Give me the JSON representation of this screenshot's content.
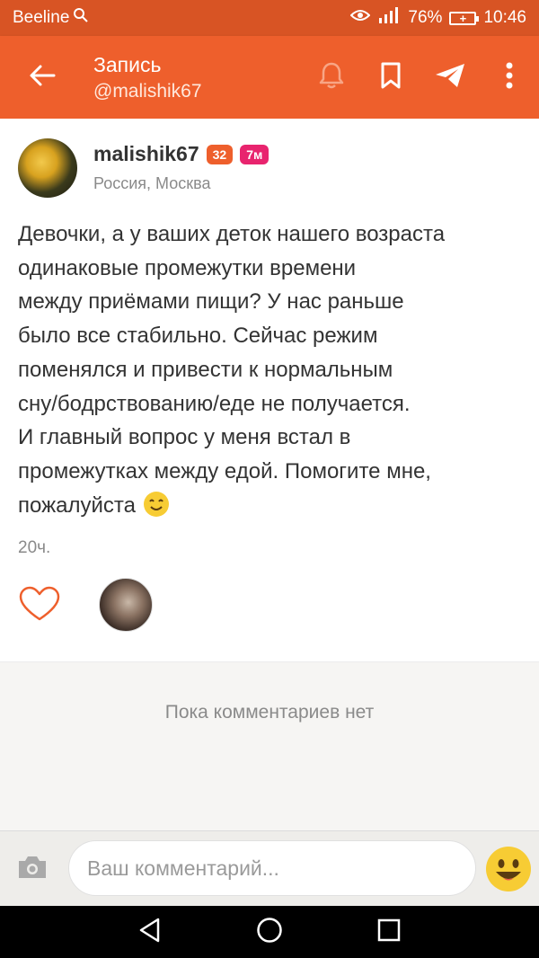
{
  "status_bar": {
    "carrier": "Beeline",
    "battery": "76%",
    "time": "10:46"
  },
  "app_bar": {
    "title": "Запись",
    "subtitle": "@malishik67",
    "icons": [
      "back-arrow-icon",
      "bell-icon",
      "bookmark-icon",
      "send-icon",
      "more-vert-icon"
    ],
    "color": "#ee5f2c"
  },
  "post": {
    "author": "malishik67",
    "badge_level": "32",
    "badge_age": "7м",
    "location": "Россия, Москва",
    "text": "Девочки, а у ваших деток нашего возраста\nодинаковые промежутки времени\nмежду приёмами пищи? У нас раньше\nбыло все стабильно. Сейчас режим\nпоменялся и привести к нормальным\nсну/бодрствованию/еде не получается.\nИ главный вопрос у меня встал в\nпромежутках между едой. Помогите мне,\nпожалуйста",
    "time": "20ч."
  },
  "comments": {
    "empty_text": "Пока комментариев нет"
  },
  "composer": {
    "placeholder": "Ваш комментарий..."
  },
  "colors": {
    "accent": "#ee5f2c",
    "status_bar": "#d85424",
    "badge_pink": "#e8246e"
  }
}
